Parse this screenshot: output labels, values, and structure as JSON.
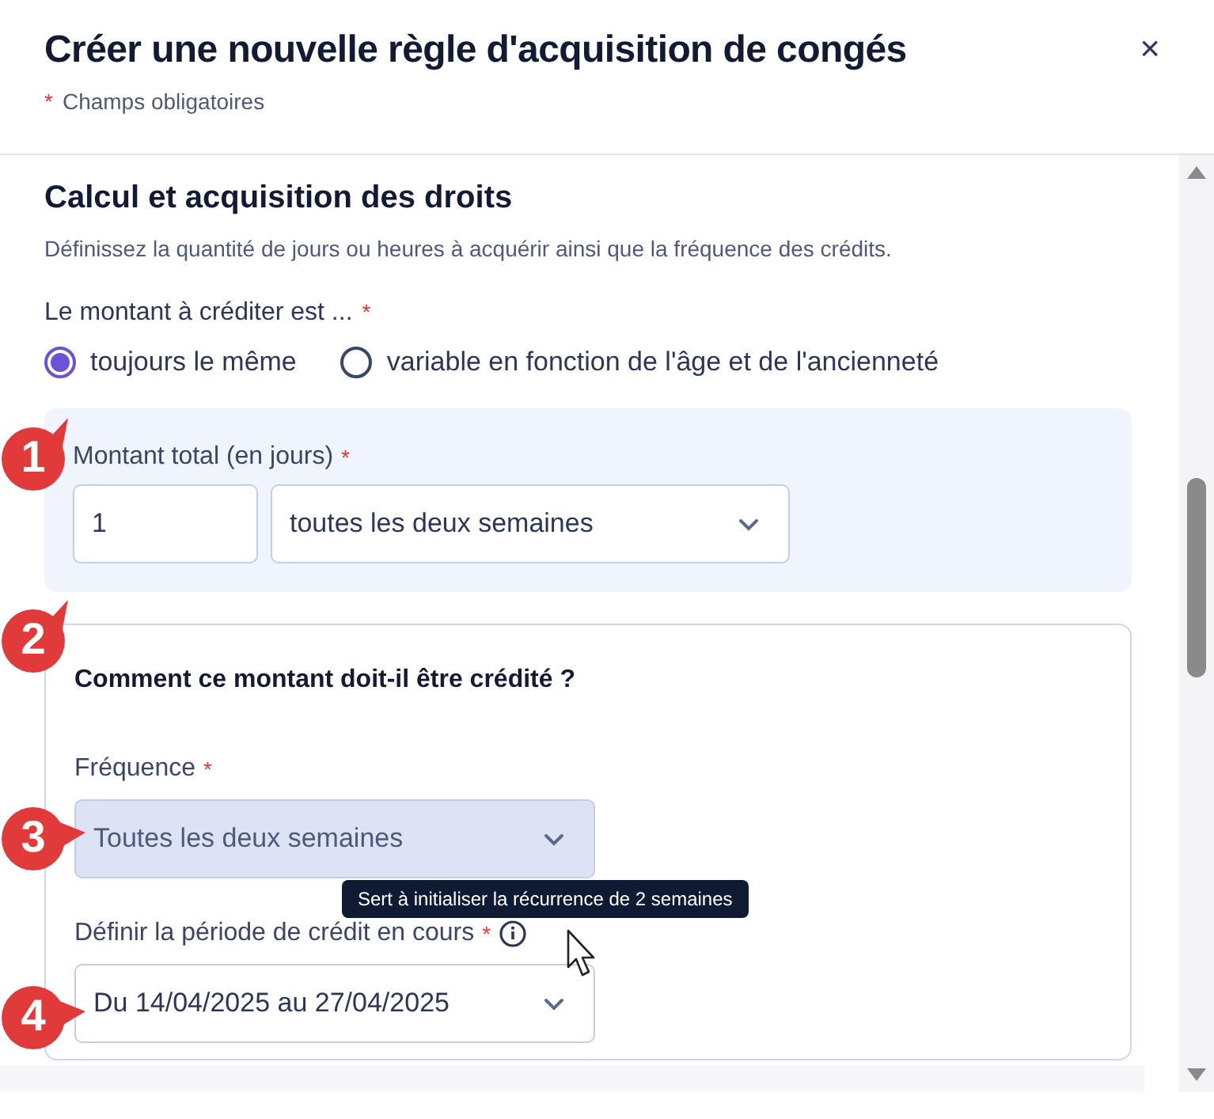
{
  "dialog": {
    "title": "Créer une nouvelle règle d'acquisition de congés",
    "close": "×",
    "required_note": {
      "mark": "*",
      "text": "Champs obligatoires"
    }
  },
  "section": {
    "title": "Calcul et acquisition des droits",
    "description": "Définissez la quantité de jours ou heures à acquérir ainsi que la fréquence des crédits.",
    "question": {
      "text": "Le montant à créditer est ...",
      "mark": "*"
    },
    "radios": [
      {
        "label": "toujours le même",
        "selected": true
      },
      {
        "label": "variable en fonction de l'âge et de l'ancienneté",
        "selected": false
      }
    ],
    "amount_panel": {
      "label": {
        "text": "Montant total (en jours)",
        "mark": "*"
      },
      "amount": "1",
      "unit": "toutes les deux semaines"
    },
    "credit_card": {
      "title": "Comment ce montant doit-il être crédité ?",
      "frequency": {
        "label": {
          "text": "Fréquence",
          "mark": "*"
        },
        "value": "Toutes les deux semaines",
        "highlighted": true
      },
      "period": {
        "label": {
          "text": "Définir la période de crédit en cours",
          "mark": "*"
        },
        "value": "Du 14/04/2025 au 27/04/2025",
        "highlighted": false
      },
      "tooltip": "Sert à initialiser la récurrence de 2 semaines"
    }
  },
  "callouts": [
    "1",
    "2",
    "3",
    "4"
  ]
}
